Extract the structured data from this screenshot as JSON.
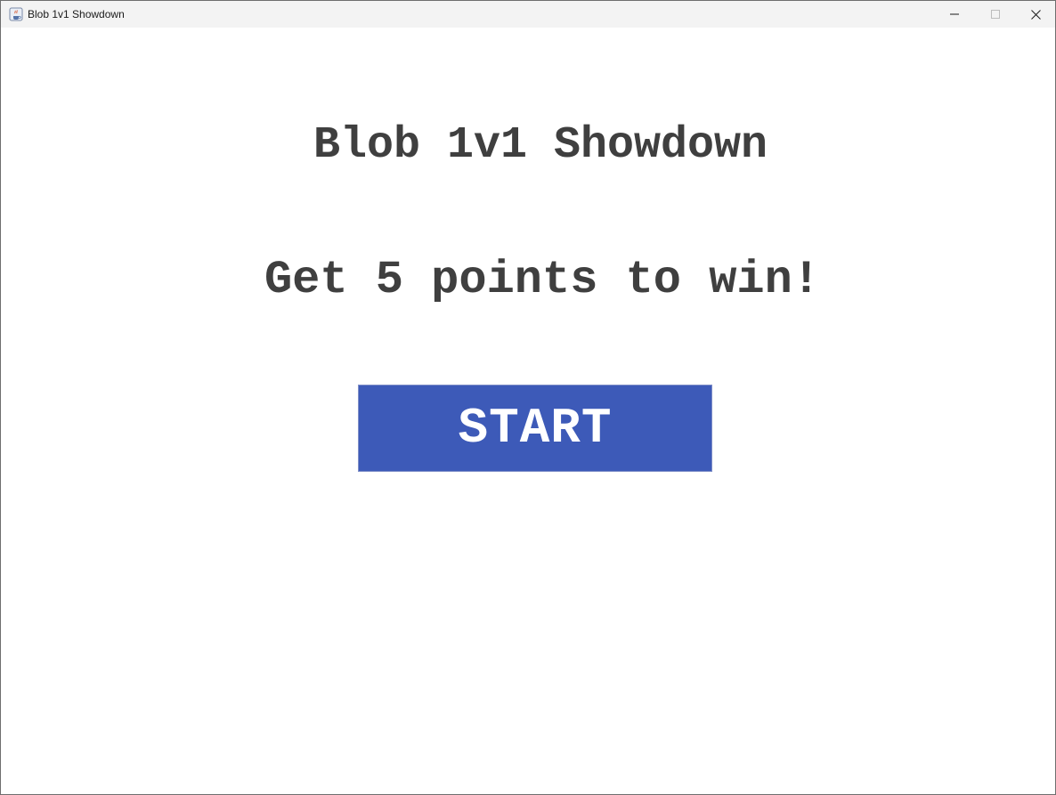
{
  "window": {
    "title": "Blob 1v1 Showdown",
    "icon": "java-cup-icon"
  },
  "screen": {
    "title": "Blob 1v1 Showdown",
    "subtitle": "Get 5 points to win!",
    "start_label": "START"
  },
  "colors": {
    "text": "#3f3f3f",
    "button": "#3d5ab8",
    "button_text": "#ffffff",
    "background": "#ffffff"
  }
}
